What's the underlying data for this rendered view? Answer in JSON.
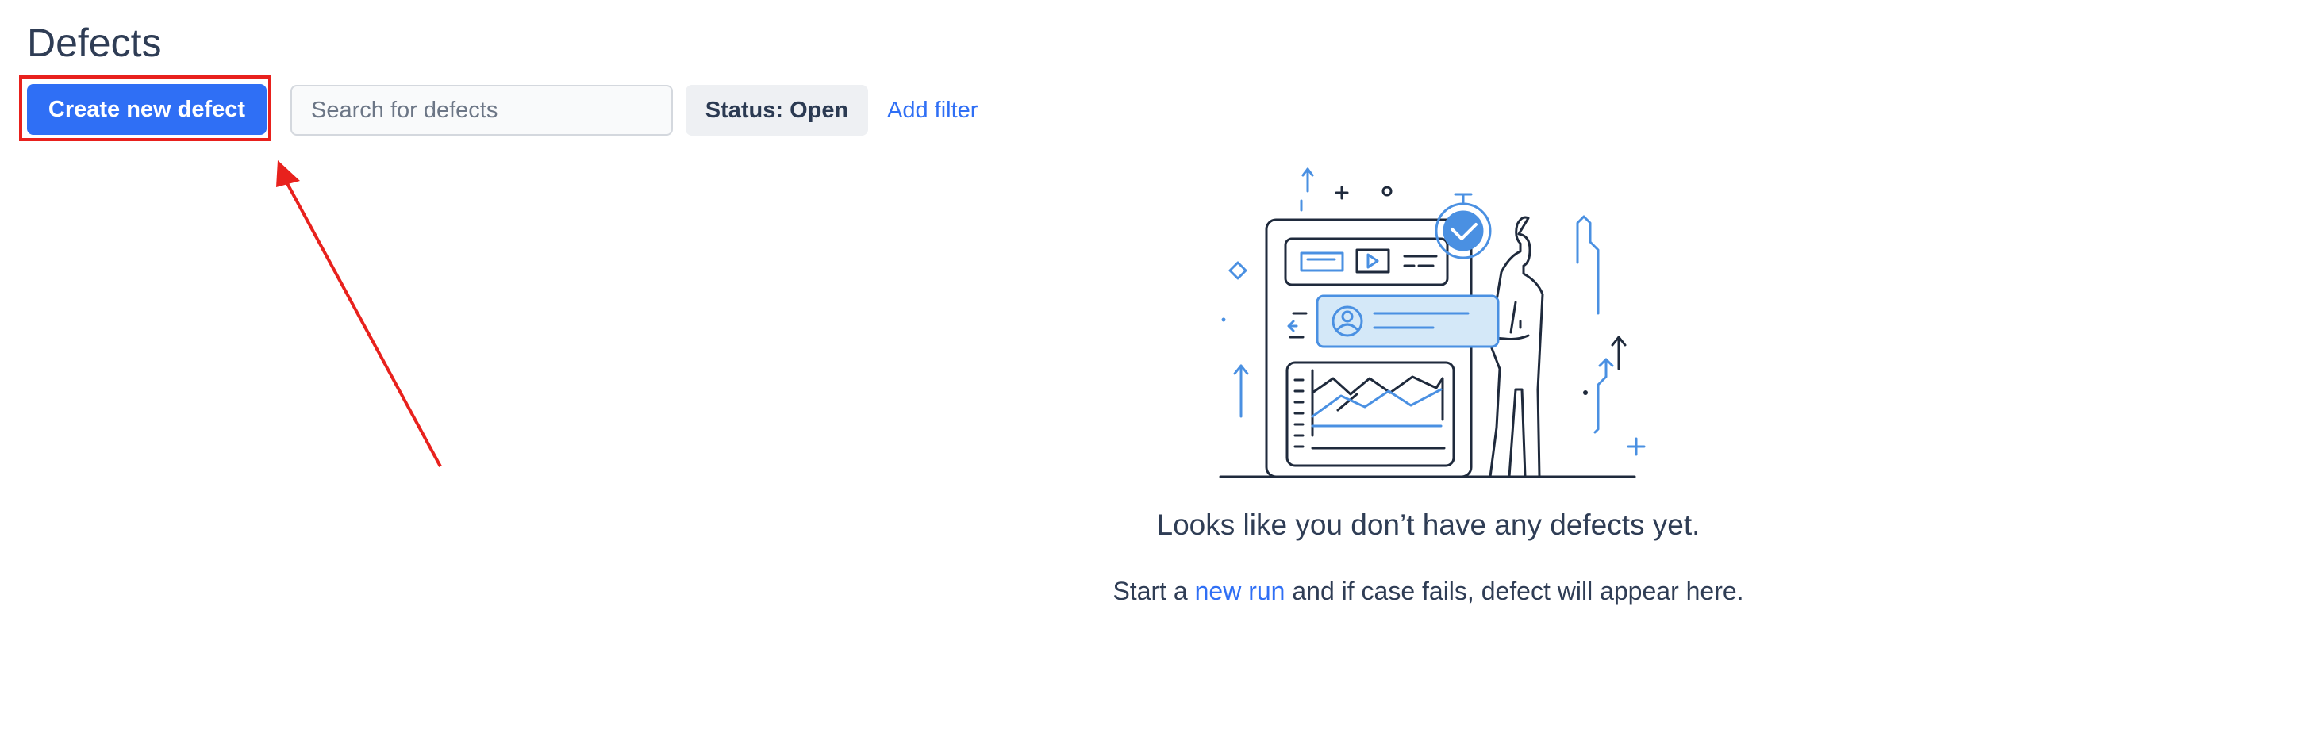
{
  "page": {
    "title": "Defects"
  },
  "toolbar": {
    "create_button_label": "Create new defect",
    "search_placeholder": "Search for defects",
    "status_filter_label": "Status: Open",
    "add_filter_label": "Add filter"
  },
  "empty_state": {
    "title": "Looks like you don’t have any defects yet.",
    "text_before": "Start a ",
    "link_label": "new run",
    "text_after": " and if case fails, defect will appear here."
  },
  "annotation": {
    "highlight_color": "#e8211d"
  },
  "colors": {
    "accent": "#2f6ff5",
    "title_text": "#2f3d55",
    "illustration_blue": "#4a90e2",
    "illustration_line": "#1f2a3c"
  }
}
